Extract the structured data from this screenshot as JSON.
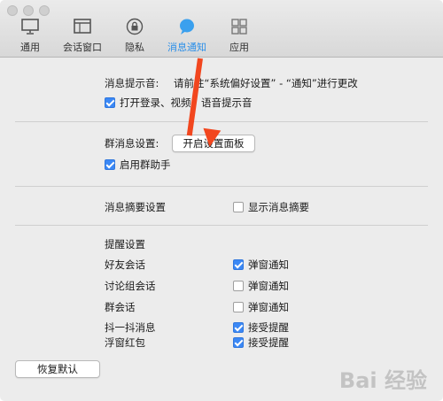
{
  "tabs": [
    {
      "label": "通用",
      "icon": "monitor-icon"
    },
    {
      "label": "会话窗口",
      "icon": "chat-window-icon"
    },
    {
      "label": "隐私",
      "icon": "lock-icon"
    },
    {
      "label": "消息通知",
      "icon": "speech-bubble-icon",
      "active": true
    },
    {
      "label": "应用",
      "icon": "apps-grid-icon"
    }
  ],
  "accent_color": "#2b8fe9",
  "annotation_color": "#f2461e",
  "sound_section": {
    "label": "消息提示音:",
    "hint": "请前往“系统偏好设置” - “通知”进行更改",
    "checkbox_label": "打开登录、视频、语音提示音",
    "checked": true
  },
  "group_section": {
    "label": "群消息设置:",
    "button_label": "开启设置面板",
    "checkbox_label": "启用群助手",
    "checked": true
  },
  "summary_section": {
    "label": "消息摘要设置",
    "checkbox_label": "显示消息摘要",
    "checked": false
  },
  "reminders": {
    "title": "提醒设置",
    "rows": [
      {
        "label": "好友会话",
        "option": "弹窗通知",
        "checked": true
      },
      {
        "label": "讨论组会话",
        "option": "弹窗通知",
        "checked": false
      },
      {
        "label": "群会话",
        "option": "弹窗通知",
        "checked": false
      },
      {
        "label": "抖一抖消息",
        "option": "接受提醒",
        "checked": true
      },
      {
        "label": "浮窗红包",
        "option": "接受提醒",
        "checked": true
      }
    ]
  },
  "restore_button": "恢复默认",
  "watermark": "Bai 经验"
}
